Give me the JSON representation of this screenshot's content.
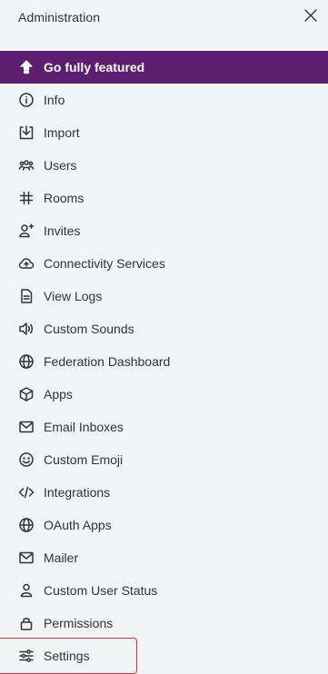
{
  "header": {
    "title": "Administration",
    "close_icon": "close-icon"
  },
  "colors": {
    "background": "#f2f3f5",
    "featured_bg": "#5c1e6e",
    "highlight_border": "#e0323c",
    "text": "#2f343d"
  },
  "nav": {
    "items": [
      {
        "label": "Go fully featured",
        "icon": "upgrade-arrow-icon"
      },
      {
        "label": "Info",
        "icon": "info-icon"
      },
      {
        "label": "Import",
        "icon": "import-icon"
      },
      {
        "label": "Users",
        "icon": "users-icon"
      },
      {
        "label": "Rooms",
        "icon": "hashtag-icon"
      },
      {
        "label": "Invites",
        "icon": "user-plus-icon"
      },
      {
        "label": "Connectivity Services",
        "icon": "cloud-icon"
      },
      {
        "label": "View Logs",
        "icon": "document-icon"
      },
      {
        "label": "Custom Sounds",
        "icon": "sound-icon"
      },
      {
        "label": "Federation Dashboard",
        "icon": "globe-icon"
      },
      {
        "label": "Apps",
        "icon": "cube-icon"
      },
      {
        "label": "Email Inboxes",
        "icon": "mail-icon"
      },
      {
        "label": "Custom Emoji",
        "icon": "emoji-icon"
      },
      {
        "label": "Integrations",
        "icon": "code-icon"
      },
      {
        "label": "OAuth Apps",
        "icon": "globe-icon"
      },
      {
        "label": "Mailer",
        "icon": "mail-icon"
      },
      {
        "label": "Custom User Status",
        "icon": "user-icon"
      },
      {
        "label": "Permissions",
        "icon": "lock-icon"
      },
      {
        "label": "Settings",
        "icon": "sliders-icon"
      }
    ]
  }
}
